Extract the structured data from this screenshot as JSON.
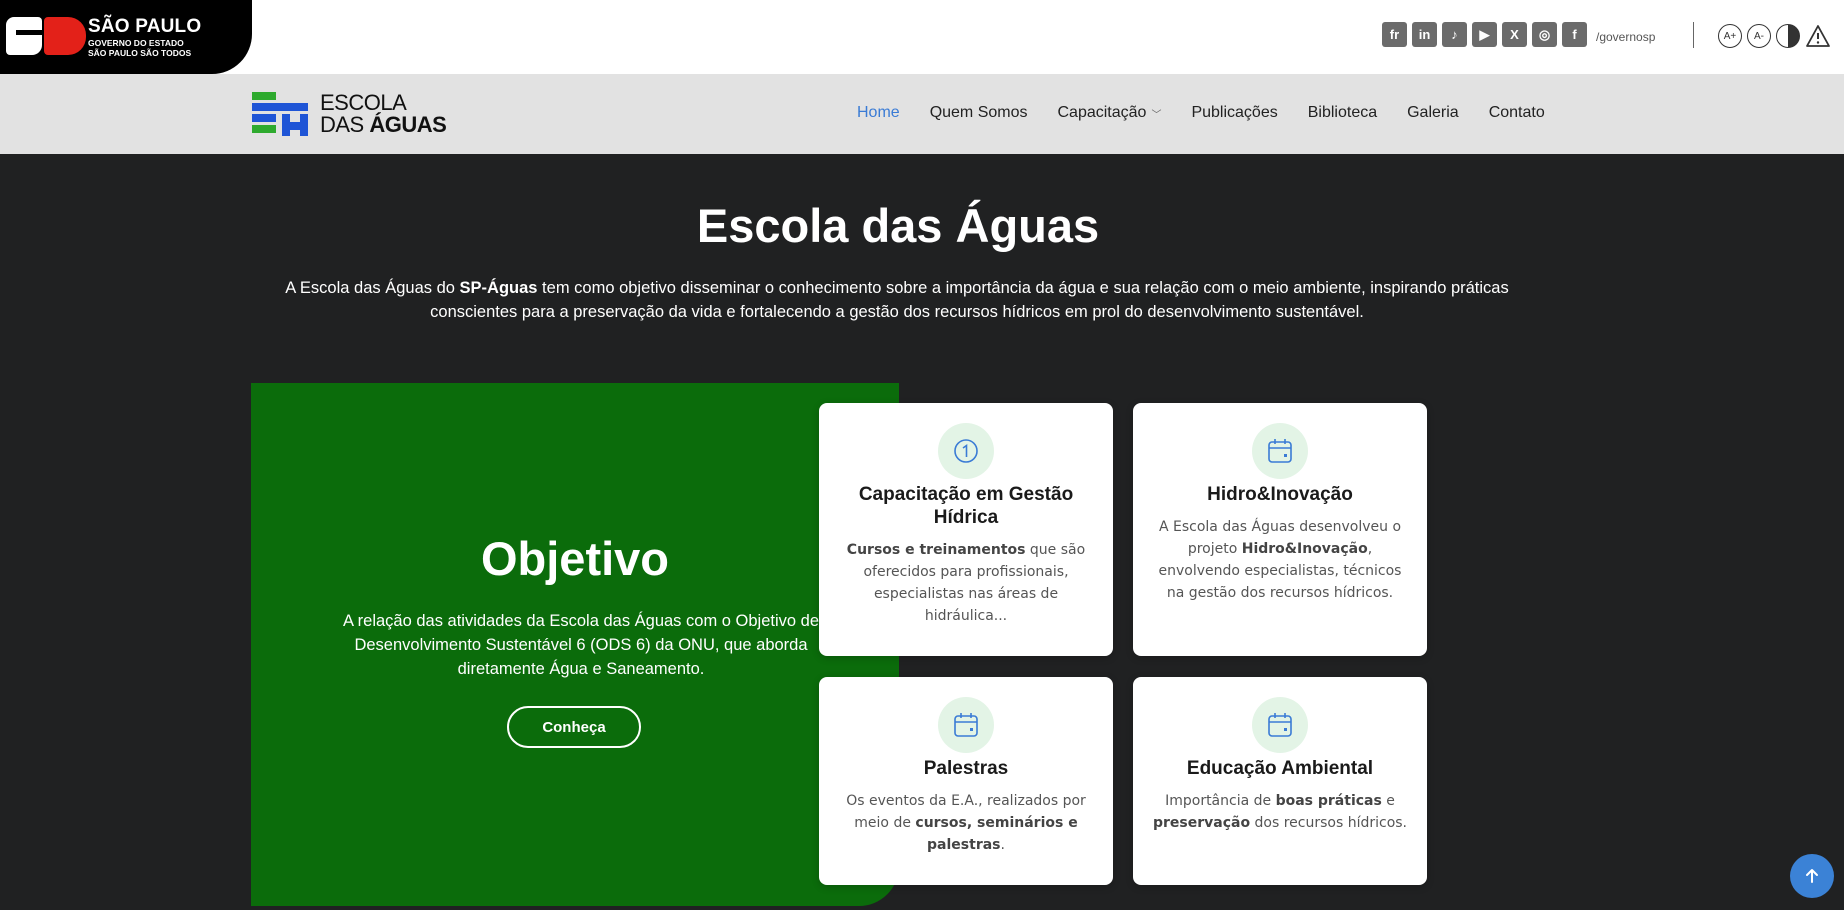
{
  "gov": {
    "state": "SÃO PAULO",
    "subtitle": "GOVERNO DO ESTADO",
    "slogan": "SÃO PAULO SÃO TODOS",
    "social_icons": [
      "flickr-icon",
      "linkedin-icon",
      "tiktok-icon",
      "youtube-icon",
      "x-icon",
      "instagram-icon",
      "facebook-icon"
    ],
    "social_glyphs": [
      "fr",
      "in",
      "♪",
      "▶",
      "X",
      "◎",
      "f"
    ],
    "handle": "/governosp",
    "a11y": {
      "increase": "A+",
      "decrease": "A-"
    }
  },
  "brand": {
    "line1": "ESCOLA",
    "line2_prefix": "DAS ",
    "line2_bold": "ÁGUAS",
    "colors": [
      "#2eaa2e",
      "#1f55d6"
    ]
  },
  "nav": {
    "items": [
      {
        "label": "Home",
        "active": true
      },
      {
        "label": "Quem Somos"
      },
      {
        "label": "Capacitação",
        "dropdown": true
      },
      {
        "label": "Publicações"
      },
      {
        "label": "Biblioteca"
      },
      {
        "label": "Galeria"
      },
      {
        "label": "Contato"
      }
    ]
  },
  "hero": {
    "title": "Escola das Águas",
    "desc_pre": "A Escola das Águas do ",
    "desc_bold": "SP-Águas",
    "desc_post": " tem como objetivo disseminar o conhecimento sobre a importância da água e sua relação com o meio ambiente, inspirando práticas conscientes para a preservação da vida e fortalecendo a gestão dos recursos hídricos em prol do desenvolvimento sustentável."
  },
  "objective": {
    "title": "Objetivo",
    "text": "A relação das atividades da Escola das Águas com o Objetivo de Desenvolvimento Sustentável 6 (ODS 6) da ONU, que aborda diretamente Água e Saneamento.",
    "button": "Conheça",
    "color": "#0b6c0b"
  },
  "cards": [
    {
      "icon": "number-one-icon",
      "title": "Capacitação em Gestão Hídrica",
      "bold": "Cursos e treinamentos",
      "text": " que são oferecidos para profissionais, especialistas nas áreas de hidráulica..."
    },
    {
      "icon": "calendar-icon",
      "title": "Hidro&Inovação",
      "pre": "A Escola das Águas desenvolveu o projeto ",
      "bold": "Hidro&Inovação",
      "text": ", envolvendo especialistas, técnicos na gestão dos recursos hídricos."
    },
    {
      "icon": "calendar-icon",
      "title": "Palestras",
      "pre": "Os eventos da E.A., realizados por meio de ",
      "bold": "cursos, seminários e palestras",
      "text": "."
    },
    {
      "icon": "calendar-icon",
      "title": "Educação Ambiental",
      "pre": "Importância de ",
      "bold": "boas práticas",
      "mid": " e ",
      "bold2": "preservação",
      "text": " dos recursos hídricos."
    }
  ],
  "accent": "#3b82d6"
}
